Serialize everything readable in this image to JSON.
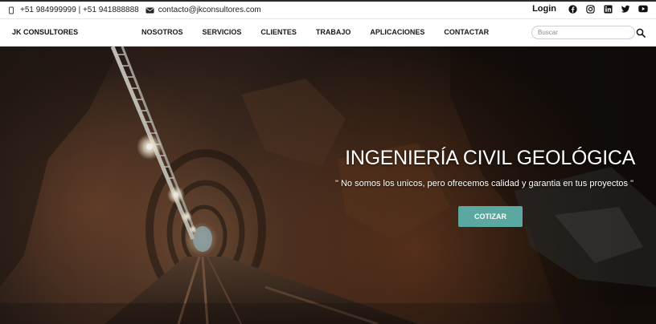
{
  "topbar": {
    "phone_icon": "phone-icon",
    "phones": "+51 984999999 | +51 941888888",
    "email_icon": "envelope-icon",
    "email": "contacto@jkconsultores.com",
    "login_label": "Login",
    "social_icons": [
      "facebook-icon",
      "instagram-icon",
      "linkedin-icon",
      "twitter-icon",
      "youtube-icon"
    ]
  },
  "navbar": {
    "brand": "JK CONSULTORES",
    "menu": [
      "NOSOTROS",
      "SERVICIOS",
      "CLIENTES",
      "TRABAJO",
      "APLICACIONES",
      "CONTACTAR"
    ],
    "search_placeholder": "Buscar",
    "search_icon": "search-icon"
  },
  "hero": {
    "title": "INGENIERÍA CIVIL GEOLÓGICA",
    "subtitle": "\" No somos los unicos, pero ofrecemos calidad y garantia en tus proyectos \"",
    "cta_label": "COTIZAR",
    "cta_color": "#5aa8a0"
  }
}
